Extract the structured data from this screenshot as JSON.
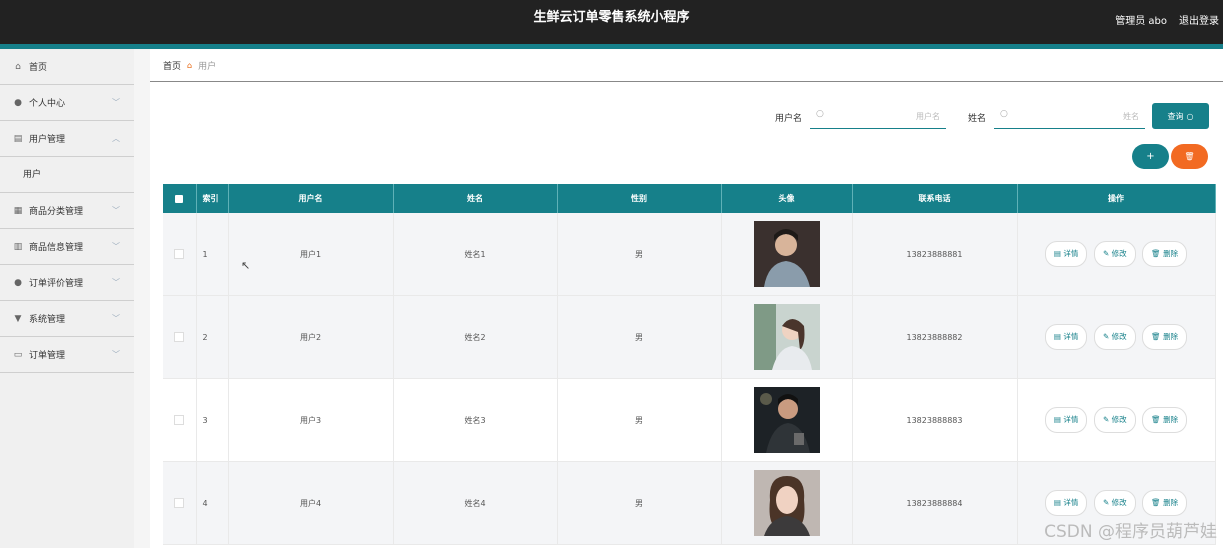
{
  "header": {
    "title": "生鲜云订单零售系统小程序",
    "admin": "管理员 abo",
    "logout": "退出登录"
  },
  "sidebar": {
    "items": [
      {
        "label": "首页",
        "icon": "home-icon",
        "glyph": "⌂"
      },
      {
        "label": "个人中心",
        "icon": "person-icon",
        "glyph": "●",
        "chevron": "﹀"
      },
      {
        "label": "用户管理",
        "icon": "clipboard-icon",
        "glyph": "▤",
        "chevron": "︿"
      },
      {
        "label": "商品分类管理",
        "icon": "grid-icon",
        "glyph": "▦",
        "chevron": "﹀"
      },
      {
        "label": "商品信息管理",
        "icon": "bank-icon",
        "glyph": "▥",
        "chevron": "﹀"
      },
      {
        "label": "订单评价管理",
        "icon": "person-icon",
        "glyph": "●",
        "chevron": "﹀"
      },
      {
        "label": "系统管理",
        "icon": "filter-icon",
        "glyph": "▼",
        "chevron": "﹀"
      },
      {
        "label": "订单管理",
        "icon": "chat-icon",
        "glyph": "▭",
        "chevron": "﹀"
      }
    ],
    "sub_item": "用户"
  },
  "breadcrumb": {
    "home": "首页",
    "current": "用户"
  },
  "search": {
    "username_label": "用户名",
    "username_placeholder": "用户名",
    "name_label": "姓名",
    "name_placeholder": "姓名",
    "query_button": "查询",
    "add_button": "+",
    "delete_button": "🗑"
  },
  "table": {
    "columns": [
      "索引",
      "用户名",
      "姓名",
      "性别",
      "头像",
      "联系电话",
      "操作"
    ],
    "rows": [
      {
        "index": "1",
        "username": "用户1",
        "name": "姓名1",
        "gender": "男",
        "phone": "13823888881"
      },
      {
        "index": "2",
        "username": "用户2",
        "name": "姓名2",
        "gender": "男",
        "phone": "13823888882"
      },
      {
        "index": "3",
        "username": "用户3",
        "name": "姓名3",
        "gender": "男",
        "phone": "13823888883"
      },
      {
        "index": "4",
        "username": "用户4",
        "name": "姓名4",
        "gender": "男",
        "phone": "13823888884"
      }
    ],
    "actions": {
      "detail": "详情",
      "edit": "修改",
      "delete": "删除"
    }
  },
  "watermark": "CSDN @程序员葫芦娃",
  "colors": {
    "accent": "#16808a",
    "danger": "#f26a22",
    "topbar": "#222222"
  }
}
